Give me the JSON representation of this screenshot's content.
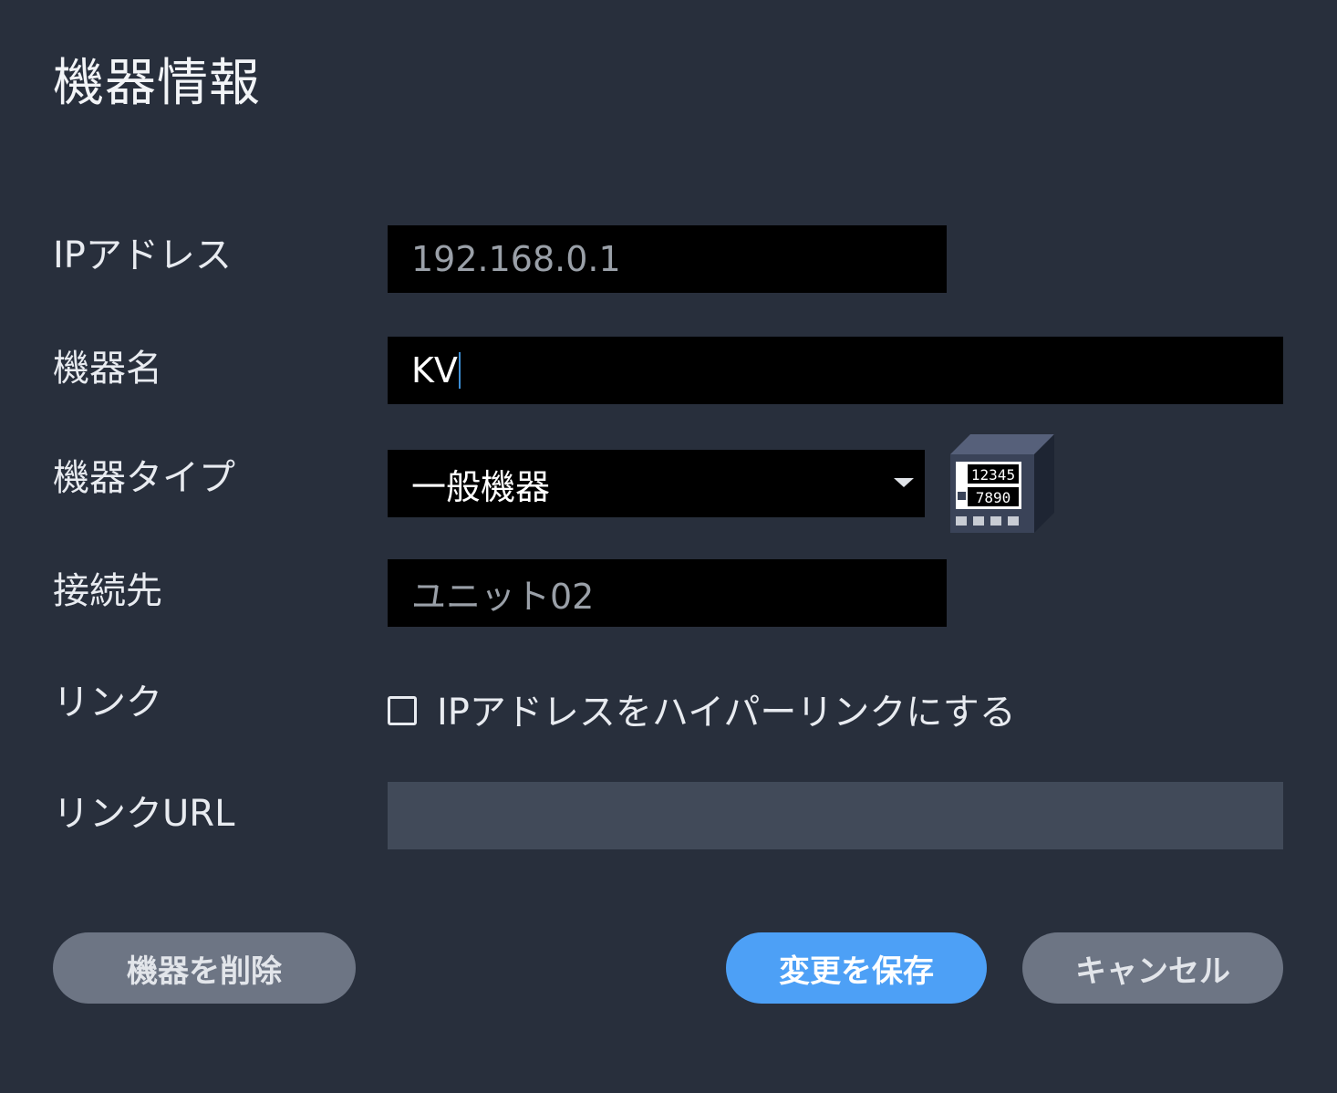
{
  "dialog": {
    "title": "機器情報"
  },
  "form": {
    "ip_label": "IPアドレス",
    "ip_value": "192.168.0.1",
    "name_label": "機器名",
    "name_value": "KV",
    "type_label": "機器タイプ",
    "type_value": "一般機器",
    "connection_label": "接続先",
    "connection_value": "ユニット02",
    "link_label": "リンク",
    "link_checkbox_label": "IPアドレスをハイパーリンクにする",
    "link_checked": false,
    "link_url_label": "リンクURL",
    "link_url_value": ""
  },
  "device_icon": {
    "icon": "panel-meter-icon",
    "display_top": "12345",
    "display_bottom": "7890"
  },
  "buttons": {
    "delete_label": "機器を削除",
    "save_label": "変更を保存",
    "cancel_label": "キャンセル"
  },
  "colors": {
    "background": "#282f3c",
    "field_bg": "#000000",
    "disabled_field_bg": "#414a59",
    "primary_button": "#4da0f6",
    "secondary_button": "#6d7584"
  }
}
